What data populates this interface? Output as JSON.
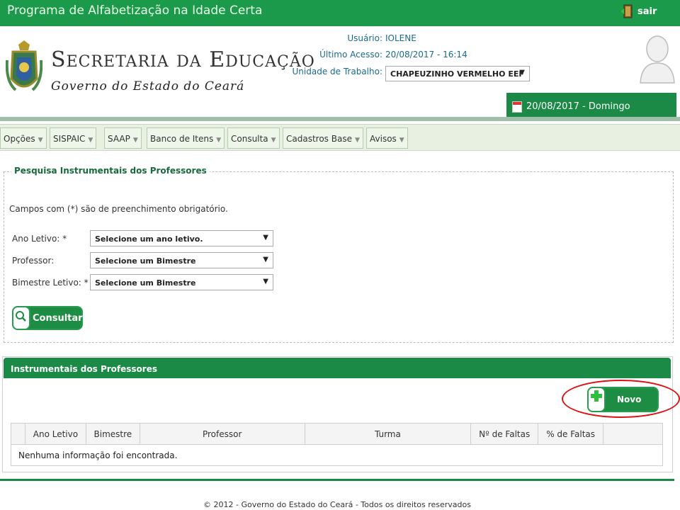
{
  "topbar": {
    "title": "Programa de Alfabetização na Idade Certa",
    "logout_label": "sair"
  },
  "header": {
    "sec_title_s": "S",
    "sec_title_ecretaria": "ECRETARIA",
    "sec_title_da": "DA",
    "sec_title_e": "E",
    "sec_title_ducacao": "DUCAÇÃO",
    "subtitle": "Governo do Estado do Ceará"
  },
  "userinfo": {
    "user_label": "Usuário:",
    "user_value": "IOLENE",
    "last_access_label": "Último Acesso:",
    "last_access_value": "20/08/2017 - 16:14",
    "unit_label": "Unidade de Trabalho:",
    "unit_value": "CHAPEUZINHO VERMELHO EEF"
  },
  "date_display": "20/08/2017 - Domingo",
  "menu": [
    {
      "label": "Opções"
    },
    {
      "label": "SISPAIC"
    },
    {
      "label": "SAAP"
    },
    {
      "label": "Banco de Itens"
    },
    {
      "label": "Consulta"
    },
    {
      "label": "Cadastros Base"
    },
    {
      "label": "Avisos"
    }
  ],
  "search": {
    "legend": "Pesquisa Instrumentais dos Professores",
    "hint": "Campos com (*) são de preenchimento obrigatório.",
    "fields": [
      {
        "label": "Ano Letivo: *",
        "value": "Selecione um ano letivo."
      },
      {
        "label": "Professor:",
        "value": "Selecione um Bimestre"
      },
      {
        "label": "Bimestre Letivo: *",
        "value": "Selecione um Bimestre"
      }
    ],
    "consult_label": "Consultar"
  },
  "results": {
    "title": "Instrumentais dos Professores",
    "new_label": "Novo",
    "columns": [
      "",
      "Ano Letivo",
      "Bimestre",
      "Professor",
      "Turma",
      "Nº de Faltas",
      "% de Faltas",
      ""
    ],
    "empty_message": "Nenhuma informação foi encontrada."
  },
  "footer": "© 2012 - Governo do Estado do Ceará - Todos os direitos reservados",
  "colors": {
    "brand_green": "#1a8a46",
    "highlight_red": "#d11111"
  }
}
